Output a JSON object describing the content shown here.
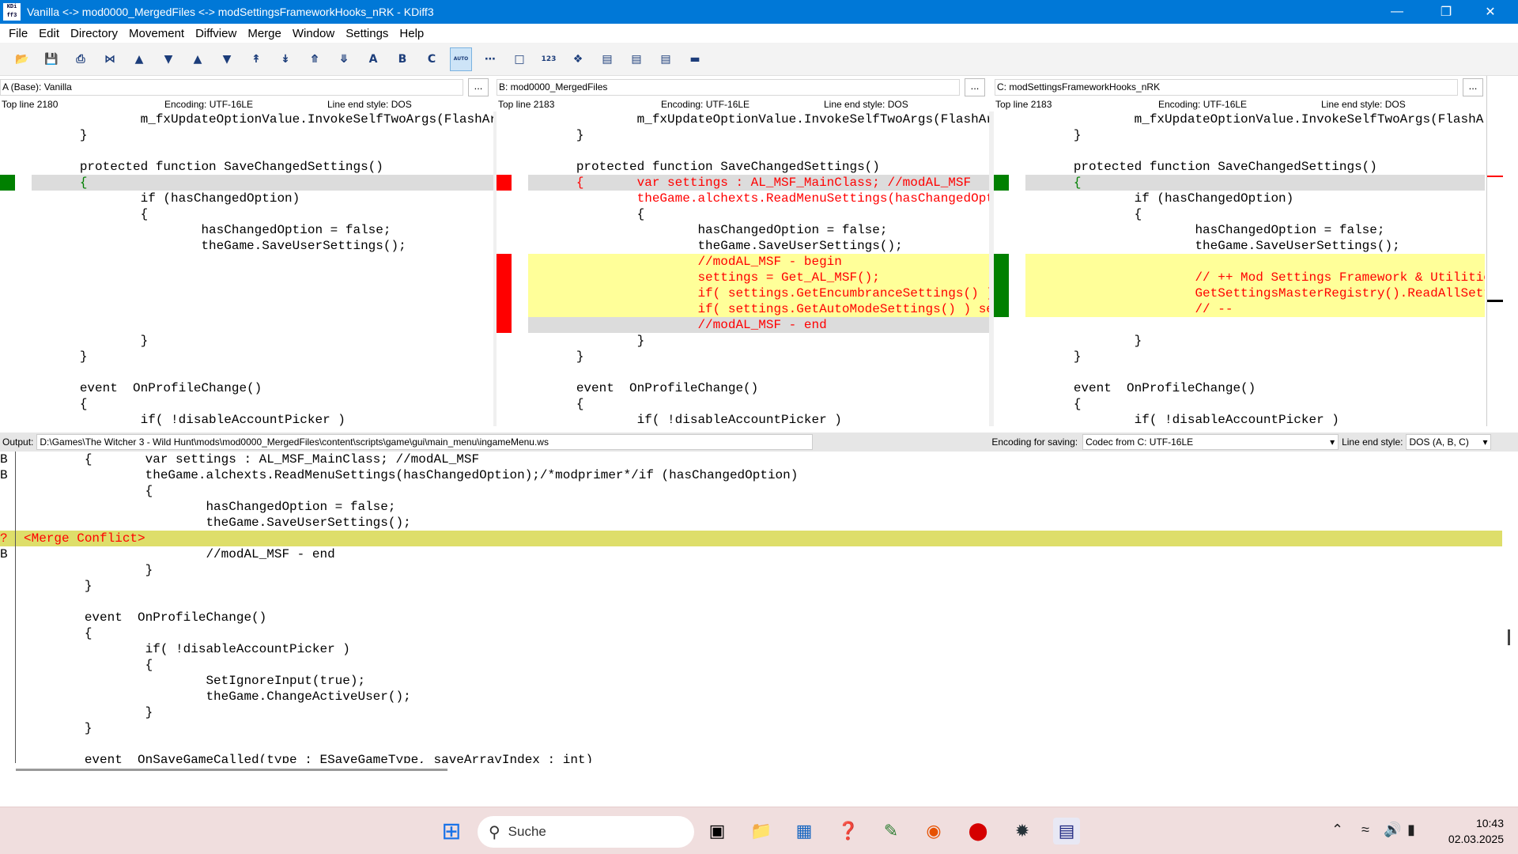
{
  "window": {
    "title": "Vanilla <-> mod0000_MergedFiles <-> modSettingsFrameworkHooks_nRK - KDiff3"
  },
  "menu": [
    "File",
    "Edit",
    "Directory",
    "Movement",
    "Diffview",
    "Merge",
    "Window",
    "Settings",
    "Help"
  ],
  "toolbar": {
    "auto_label": "AUTO",
    "label_123": "123",
    "label_a": "A",
    "label_b": "B",
    "label_c": "C"
  },
  "panes": [
    {
      "name": "A (Base):  Vanilla",
      "dots": "...",
      "top_line": "Top line 2180",
      "encoding": "Encoding: UTF-16LE",
      "line_end": "Line end style: DOS",
      "accent": "#008000",
      "lines": [
        {
          "t": "                m_fxUpdateOptionValue.InvokeSelfTwoArgs(FlashArgUInt(id), FlashArgString(value));"
        },
        {
          "t": "        }"
        },
        {
          "t": ""
        },
        {
          "t": "        protected function SaveChangedSettings()"
        },
        {
          "t": "        {",
          "hl": true,
          "col": "#008000"
        },
        {
          "t": "                if (hasChangedOption)",
          "col": "#000"
        },
        {
          "t": "                {"
        },
        {
          "t": "                        hasChangedOption = false;"
        },
        {
          "t": "                        theGame.SaveUserSettings();"
        },
        {
          "t": ""
        },
        {
          "t": ""
        },
        {
          "t": ""
        },
        {
          "t": ""
        },
        {
          "t": ""
        },
        {
          "t": "                }"
        },
        {
          "t": "        }"
        },
        {
          "t": ""
        },
        {
          "t": "        event  OnProfileChange()"
        },
        {
          "t": "        {"
        },
        {
          "t": "                if( !disableAccountPicker )"
        }
      ]
    },
    {
      "name": "B:  mod0000_MergedFiles",
      "dots": "...",
      "top_line": "Top line 2183",
      "encoding": "Encoding: UTF-16LE",
      "line_end": "Line end style: DOS",
      "accent": "#ff0000",
      "lines": [
        {
          "t": "                m_fxUpdateOptionValue.InvokeSelfTwoArgs(FlashArgUInt(id), FlashArgString(value));"
        },
        {
          "t": "        }"
        },
        {
          "t": ""
        },
        {
          "t": "        protected function SaveChangedSettings()"
        },
        {
          "t": "        {       var settings : AL_MSF_MainClass; //modAL_MSF",
          "hl": true,
          "col": "#ff0000"
        },
        {
          "t": "                theGame.alchexts.ReadMenuSettings(hasChangedOption);/*modprimer*/if (hasChangedOption)",
          "col": "#ff0000"
        },
        {
          "t": "                {"
        },
        {
          "t": "                        hasChangedOption = false;"
        },
        {
          "t": "                        theGame.SaveUserSettings();"
        },
        {
          "t": "                        //modAL_MSF - begin",
          "y": true,
          "col": "#ff0000"
        },
        {
          "t": "                        settings = Get_AL_MSF();",
          "y": true,
          "col": "#ff0000"
        },
        {
          "t": "                        if( settings.GetEncumbranceSettings() ) settings.ReadAll();",
          "y": true,
          "col": "#ff0000"
        },
        {
          "t": "                        if( settings.GetAutoModeSettings() ) settings.ReadAll();",
          "y": true,
          "col": "#ff0000"
        },
        {
          "t": "                        //modAL_MSF - end",
          "hl": true,
          "col": "#ff0000"
        },
        {
          "t": "                }"
        },
        {
          "t": "        }"
        },
        {
          "t": ""
        },
        {
          "t": "        event  OnProfileChange()"
        },
        {
          "t": "        {"
        },
        {
          "t": "                if( !disableAccountPicker )"
        }
      ]
    },
    {
      "name": "C:  modSettingsFrameworkHooks_nRK",
      "dots": "...",
      "top_line": "Top line 2183",
      "encoding": "Encoding: UTF-16LE",
      "line_end": "Line end style: DOS",
      "accent": "#008000",
      "lines": [
        {
          "t": "                m_fxUpdateOptionValue.InvokeSelfTwoArgs(FlashArgUInt(id), FlashArgString(value));"
        },
        {
          "t": "        }"
        },
        {
          "t": ""
        },
        {
          "t": "        protected function SaveChangedSettings()"
        },
        {
          "t": "        {",
          "hl": true,
          "col": "#008000"
        },
        {
          "t": "                if (hasChangedOption)"
        },
        {
          "t": "                {"
        },
        {
          "t": "                        hasChangedOption = false;"
        },
        {
          "t": "                        theGame.SaveUserSettings();"
        },
        {
          "t": "",
          "y": true
        },
        {
          "t": "                        // ++ Mod Settings Framework & Utilities",
          "y": true,
          "col": "#ff0000"
        },
        {
          "t": "                        GetSettingsMasterRegistry().ReadAllSettings();",
          "y": true,
          "col": "#ff0000"
        },
        {
          "t": "                        // --",
          "y": true,
          "col": "#ff0000"
        },
        {
          "t": ""
        },
        {
          "t": "                }"
        },
        {
          "t": "        }"
        },
        {
          "t": ""
        },
        {
          "t": "        event  OnProfileChange()"
        },
        {
          "t": "        {"
        },
        {
          "t": "                if( !disableAccountPicker )"
        }
      ]
    }
  ],
  "output": {
    "label": "Output:",
    "path": "D:\\Games\\The Witcher 3 - Wild Hunt\\mods\\mod0000_MergedFiles\\content\\scripts\\game\\gui\\main_menu\\ingameMenu.ws",
    "enc_label": "Encoding for saving:",
    "enc_value": "Codec from C: UTF-16LE",
    "le_label": "Line end style:",
    "le_value": "DOS (A, B, C)"
  },
  "merge": [
    {
      "src": "B",
      "t": "        {       var settings : AL_MSF_MainClass; //modAL_MSF"
    },
    {
      "src": "B",
      "t": "                theGame.alchexts.ReadMenuSettings(hasChangedOption);/*modprimer*/if (hasChangedOption)"
    },
    {
      "src": "",
      "t": "                {"
    },
    {
      "src": "",
      "t": "                        hasChangedOption = false;"
    },
    {
      "src": "",
      "t": "                        theGame.SaveUserSettings();"
    },
    {
      "src": "?",
      "t": "<Merge Conflict>",
      "conflict": true
    },
    {
      "src": "B",
      "t": "                        //modAL_MSF - end"
    },
    {
      "src": "",
      "t": "                }"
    },
    {
      "src": "",
      "t": "        }"
    },
    {
      "src": "",
      "t": ""
    },
    {
      "src": "",
      "t": "        event  OnProfileChange()"
    },
    {
      "src": "",
      "t": "        {"
    },
    {
      "src": "",
      "t": "                if( !disableAccountPicker )"
    },
    {
      "src": "",
      "t": "                {"
    },
    {
      "src": "",
      "t": "                        SetIgnoreInput(true);"
    },
    {
      "src": "",
      "t": "                        theGame.ChangeActiveUser();"
    },
    {
      "src": "",
      "t": "                }"
    },
    {
      "src": "",
      "t": "        }"
    },
    {
      "src": "",
      "t": ""
    },
    {
      "src": "",
      "t": "        event  OnSaveGameCalled(type : ESaveGameType, saveArrayIndex : int)"
    }
  ],
  "taskbar": {
    "search_placeholder": "Suche",
    "time": "10:43",
    "date": "02.03.2025"
  },
  "colors": {
    "diff_yellow": "#ffff99",
    "conflict": "#dede6a",
    "removed_red": "#ff0000",
    "added_green": "#008000"
  }
}
